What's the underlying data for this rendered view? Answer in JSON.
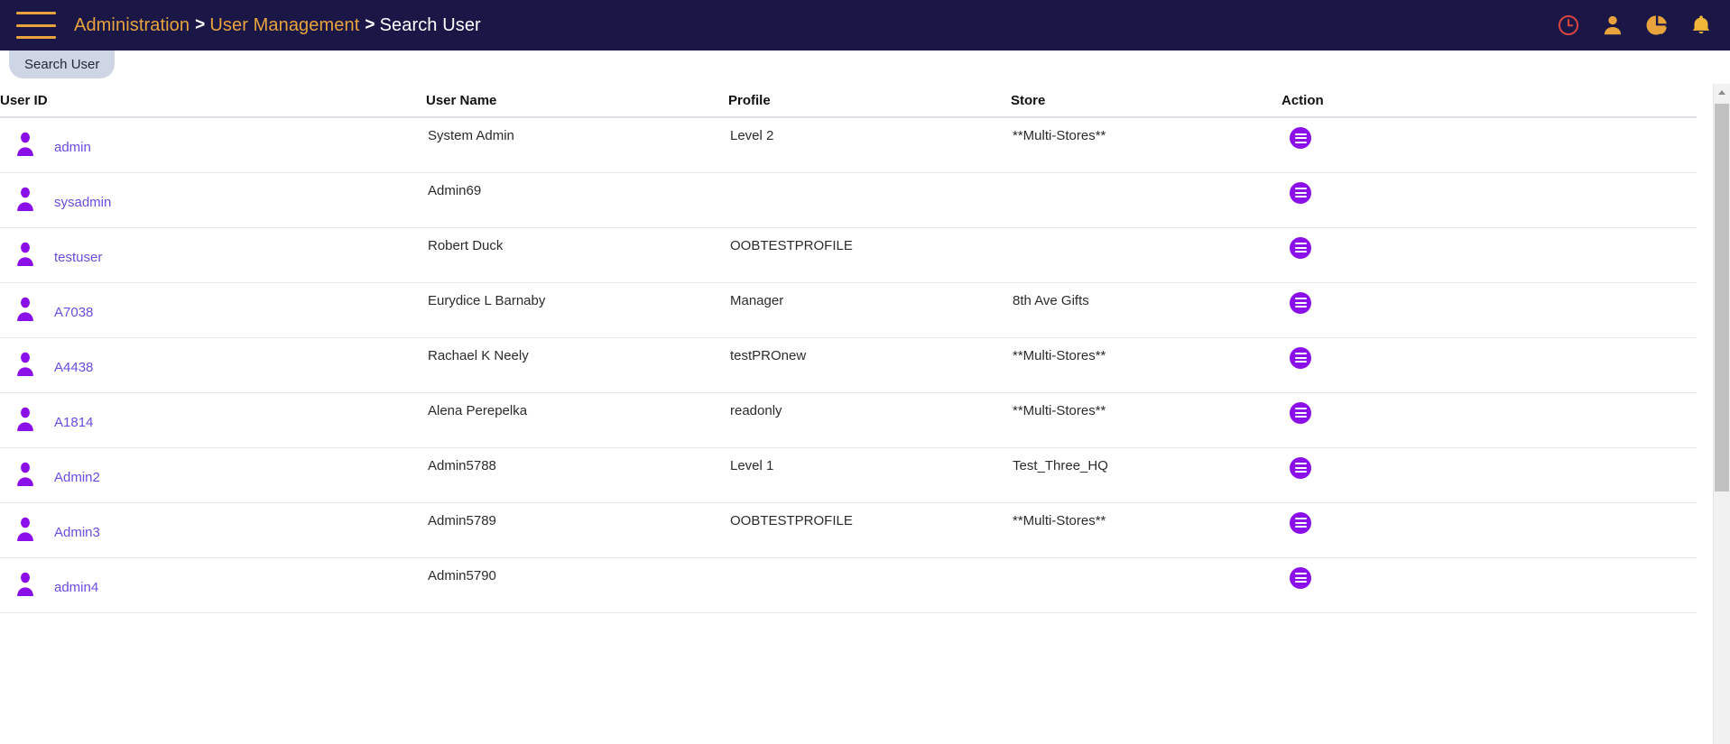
{
  "topbar": {
    "menu_icon": "hamburger-menu-icon",
    "breadcrumb": {
      "items": [
        {
          "label": "Administration",
          "is_link": true
        },
        {
          "label": "User Management",
          "is_link": true
        },
        {
          "label": "Search User",
          "is_link": false
        }
      ],
      "separator": ">"
    },
    "icons": [
      {
        "name": "clock-icon",
        "color": "#d4433f"
      },
      {
        "name": "user-profile-icon",
        "color": "#e8a33d"
      },
      {
        "name": "pie-chart-icon",
        "color": "#e8a33d"
      },
      {
        "name": "notification-bell-icon",
        "color": "#f0b63a"
      }
    ],
    "background_color": "#1a1747",
    "link_color": "#e8a33d"
  },
  "tabs": [
    {
      "label": "Search User",
      "active": true
    }
  ],
  "table": {
    "columns": [
      {
        "key": "user_id",
        "label": "User ID"
      },
      {
        "key": "user_name",
        "label": "User Name"
      },
      {
        "key": "profile",
        "label": "Profile"
      },
      {
        "key": "store",
        "label": "Store"
      },
      {
        "key": "action",
        "label": "Action"
      }
    ],
    "rows": [
      {
        "user_id": "admin",
        "user_name": "System Admin",
        "profile": "Level 2",
        "store": "**Multi-Stores**"
      },
      {
        "user_id": "sysadmin",
        "user_name": "Admin69",
        "profile": "",
        "store": ""
      },
      {
        "user_id": "testuser",
        "user_name": "Robert Duck",
        "profile": "OOBTESTPROFILE",
        "store": ""
      },
      {
        "user_id": "A7038",
        "user_name": "Eurydice L Barnaby",
        "profile": "Manager",
        "store": "8th Ave Gifts"
      },
      {
        "user_id": "A4438",
        "user_name": "Rachael K Neely",
        "profile": "testPROnew",
        "store": "**Multi-Stores**"
      },
      {
        "user_id": "A1814",
        "user_name": "Alena Perepelka",
        "profile": "readonly",
        "store": "**Multi-Stores**"
      },
      {
        "user_id": "Admin2",
        "user_name": "Admin5788",
        "profile": "Level 1",
        "store": "Test_Three_HQ"
      },
      {
        "user_id": "Admin3",
        "user_name": "Admin5789",
        "profile": "OOBTESTPROFILE",
        "store": "**Multi-Stores**"
      },
      {
        "user_id": "admin4",
        "user_name": "Admin5790",
        "profile": "",
        "store": ""
      }
    ],
    "row_action_icon": "menu-lines-icon",
    "avatar_icon": "user-avatar-icon",
    "link_color": "#6a4ce0",
    "action_icon_color": "#8a0fe8"
  },
  "scrollbar": {
    "up_arrow_icon": "scroll-up-arrow-icon",
    "orientation": "vertical"
  }
}
